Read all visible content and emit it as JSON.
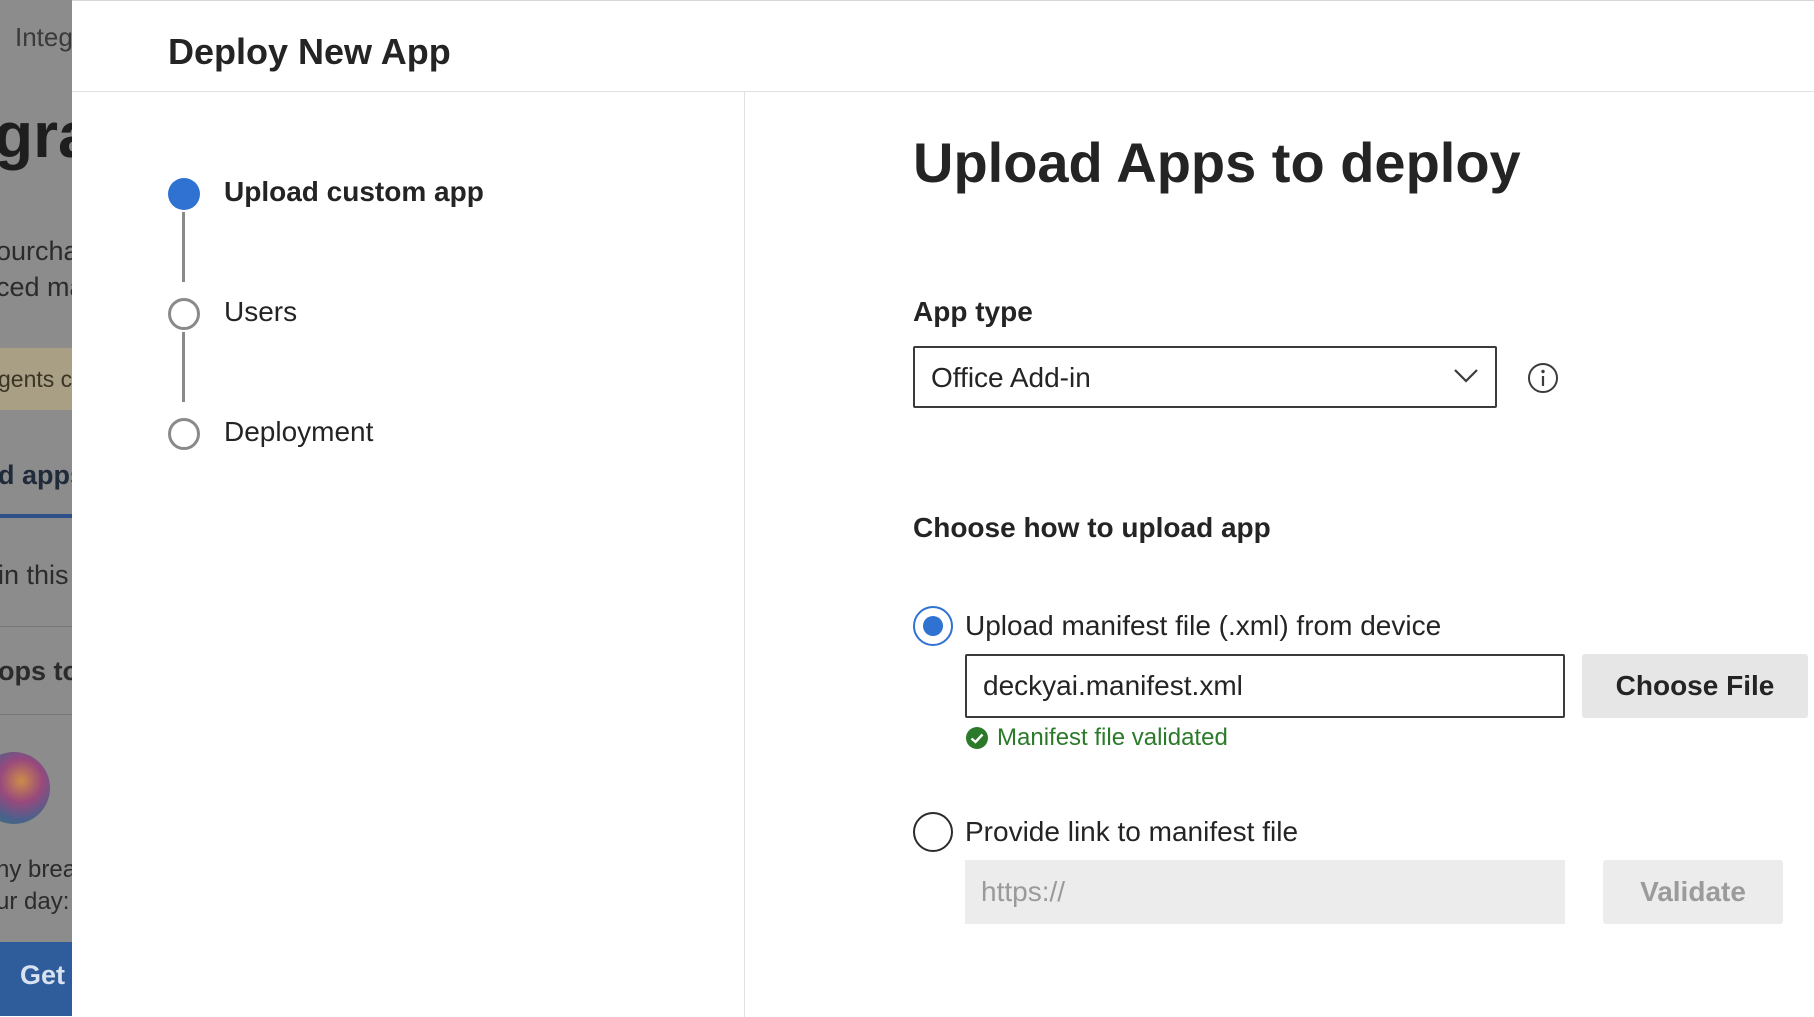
{
  "background_page": {
    "fragments": {
      "integ": "Integ",
      "heading": "gra",
      "purcha": "ourcha",
      "ced": "ced ma",
      "agents": "gents ca",
      "dapps": "d apps",
      "inthis": "in this",
      "opsto": "ops to",
      "ybrea": "ny brea",
      "urday": "ur day:",
      "get": "Get"
    }
  },
  "panel": {
    "title": "Deploy New App"
  },
  "stepper": {
    "steps": [
      {
        "label": "Upload custom app",
        "state": "active"
      },
      {
        "label": "Users",
        "state": "pending"
      },
      {
        "label": "Deployment",
        "state": "pending"
      }
    ]
  },
  "main": {
    "heading": "Upload Apps to deploy",
    "app_type": {
      "label": "App type",
      "selected": "Office Add-in",
      "icon": "chevron-down-icon",
      "info_icon": "info-icon"
    },
    "upload_method": {
      "label": "Choose how to upload app",
      "options": [
        {
          "label": "Upload manifest file (.xml) from device",
          "checked": true,
          "file_value": "deckyai.manifest.xml",
          "button": "Choose File",
          "status": "Manifest file validated",
          "status_icon": "check-circle-icon"
        },
        {
          "label": "Provide link to manifest file",
          "checked": false,
          "placeholder": "https://",
          "button": "Validate"
        }
      ]
    }
  },
  "colors": {
    "accent": "#2f72d1",
    "success": "#2a7a2a",
    "dim_overlay": "#8c8c8c"
  }
}
